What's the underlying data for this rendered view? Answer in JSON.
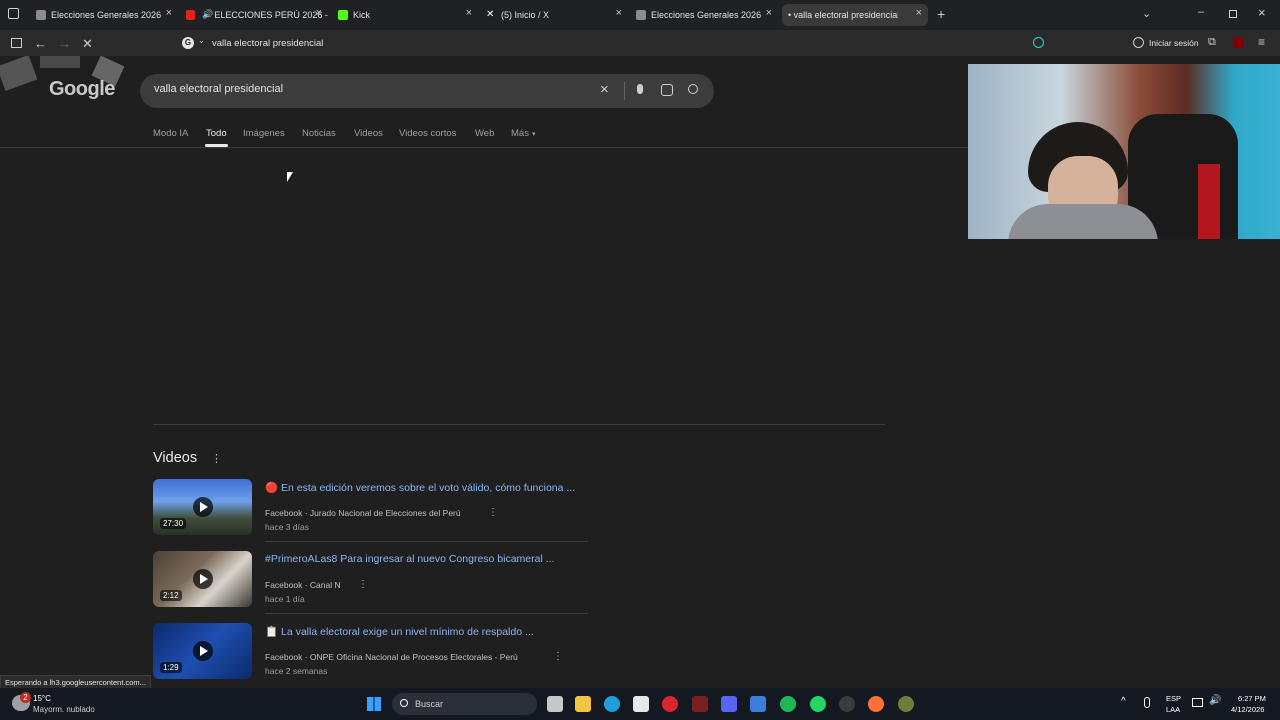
{
  "browser": {
    "tabs": [
      {
        "title": "Elecciones Generales 2026",
        "favicon": "document-icon"
      },
      {
        "title": "ELECCIONES PERÚ 2026 - E",
        "favicon": "youtube-icon"
      },
      {
        "title": "Kick",
        "favicon": "kick-icon"
      },
      {
        "title": "(5) Inicio / X",
        "favicon": "x-icon"
      },
      {
        "title": "Elecciones Generales 2026",
        "favicon": "document-icon"
      },
      {
        "title": "• valla electoral presidencial - Bu",
        "favicon": "google-icon"
      }
    ],
    "address": "valla electoral presidencial",
    "signin_label": "Iniciar sesión"
  },
  "search": {
    "query": "valla electoral presidencial",
    "logo_text": "Google"
  },
  "nav_tabs": [
    "Modo IA",
    "Todo",
    "Imágenes",
    "Noticias",
    "Videos",
    "Videos cortos",
    "Web",
    "Más"
  ],
  "active_tab": "Todo",
  "videos_section": {
    "heading": "Videos",
    "items": [
      {
        "title": "🔴 En esta edición veremos sobre el voto válido, cómo funciona ...",
        "source": "Facebook · Jurado Nacional de Elecciones del Perú",
        "time": "hace 3 días",
        "duration": "27:30"
      },
      {
        "title": "#PrimeroALas8 Para ingresar al nuevo Congreso bicameral ...",
        "source": "Facebook · Canal N",
        "time": "hace 1 día",
        "duration": "2:12"
      },
      {
        "title": "📋 La valla electoral exige un nivel mínimo de respaldo ...",
        "source": "Facebook · ONPE Oficina Nacional de Procesos Electorales - Perú",
        "time": "hace 2 semanas",
        "duration": "1:29"
      }
    ]
  },
  "status_text": "Esperando a lh3.googleusercontent.com...",
  "taskbar": {
    "weather_temp": "15°C",
    "weather_desc": "Mayorm. nublado",
    "search_placeholder": "Buscar",
    "lang_top": "ESP",
    "lang_bottom": "LAA",
    "time": "6:27 PM",
    "date": "4/12/2026",
    "weather_badge": "2"
  }
}
